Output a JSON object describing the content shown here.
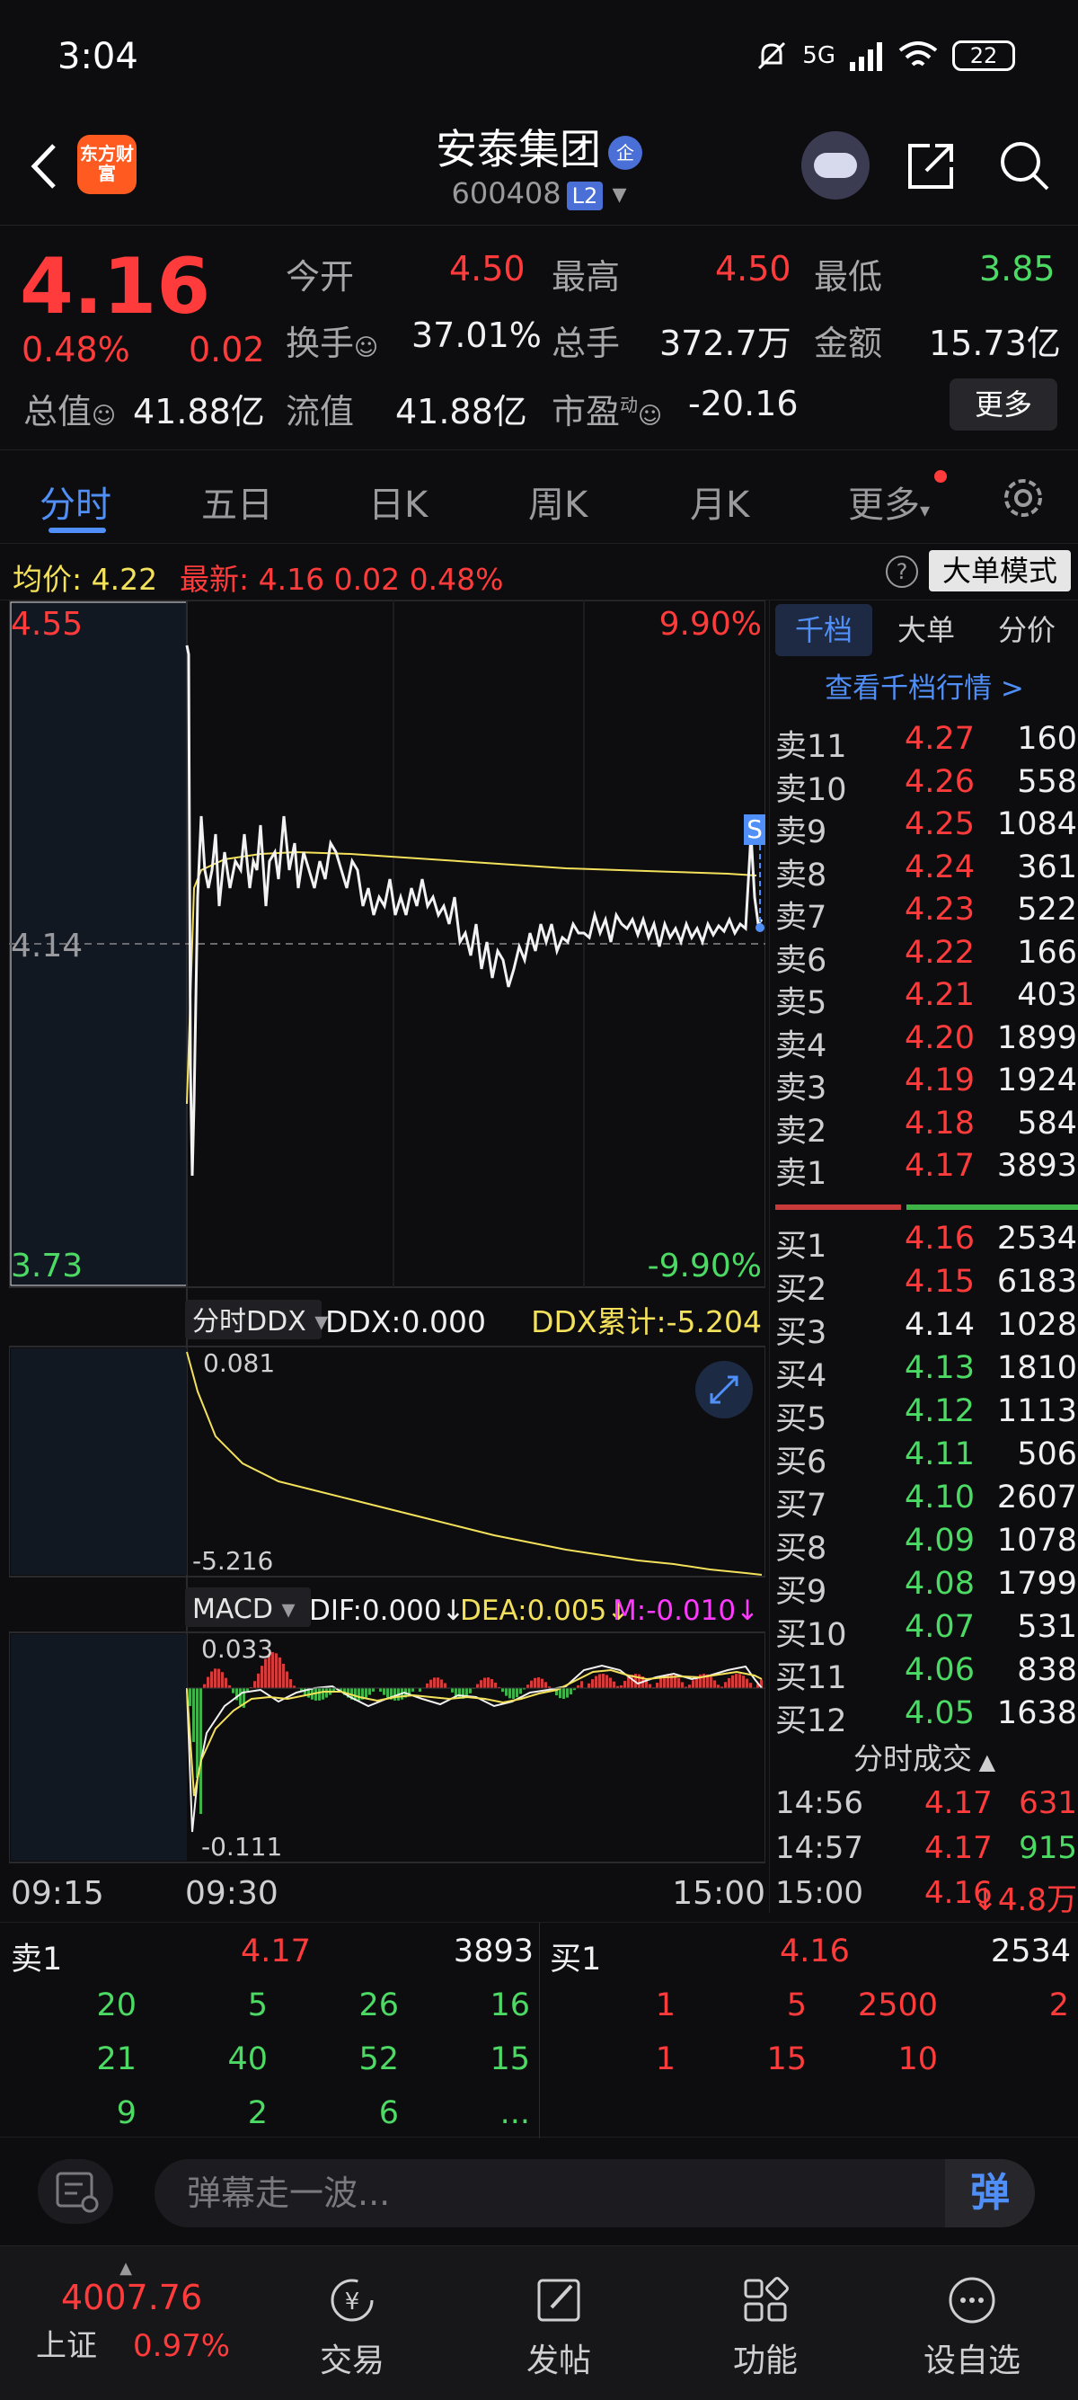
{
  "status": {
    "time": "3:04",
    "network": "5G",
    "battery": "22"
  },
  "header": {
    "logo": "东方财富",
    "name": "安泰集团",
    "ent_badge": "企",
    "code": "600408",
    "level": "L2"
  },
  "quote": {
    "price": "4.16",
    "pct": "0.48%",
    "change": "0.02",
    "fields": [
      {
        "label": "今开",
        "value": "4.50",
        "color": "red"
      },
      {
        "label": "最高",
        "value": "4.50",
        "color": "red"
      },
      {
        "label": "最低",
        "value": "3.85",
        "color": "green"
      },
      {
        "label": "换手",
        "value": "37.01%",
        "color": "white"
      },
      {
        "label": "总手",
        "value": "372.7万",
        "color": "white"
      },
      {
        "label": "金额",
        "value": "15.73亿",
        "color": "white"
      },
      {
        "label": "总值",
        "value": "41.88亿",
        "color": "white"
      },
      {
        "label": "流值",
        "value": "41.88亿",
        "color": "white"
      },
      {
        "label": "市盈",
        "value": "-20.16",
        "color": "white"
      }
    ],
    "pe_sup": "动",
    "more": "更多"
  },
  "tabs": [
    "分时",
    "五日",
    "日K",
    "周K",
    "月K",
    "更多"
  ],
  "info_line": {
    "avg_label": "均价:",
    "avg": "4.22",
    "latest_label": "最新:",
    "latest": "4.16",
    "change": "0.02",
    "pct": "0.48%",
    "mode": "大单模式"
  },
  "chart": {
    "price_high": "4.55",
    "price_mid": "4.14",
    "price_low": "3.73",
    "pct_high": "9.90%",
    "pct_low": "-9.90%",
    "ddx_selector": "分时DDX",
    "ddx": "DDX:0.000",
    "ddx_cum": "DDX累计:-5.204",
    "ddx_top": "0.081",
    "ddx_bottom": "-5.216",
    "macd_selector": "MACD",
    "dif": "DIF:0.000",
    "dea": "DEA:0.005",
    "m": "M:-0.010",
    "macd_top": "0.033",
    "macd_bottom": "-0.111",
    "time_start": "09:15",
    "time_open": "09:30",
    "time_end": "15:00",
    "s_marker": "S"
  },
  "book": {
    "tabs": [
      "千档",
      "大单",
      "分价"
    ],
    "view_link": "查看千档行情 >",
    "asks": [
      {
        "label": "卖11",
        "price": "4.27",
        "vol": "160"
      },
      {
        "label": "卖10",
        "price": "4.26",
        "vol": "558"
      },
      {
        "label": "卖9",
        "price": "4.25",
        "vol": "1084"
      },
      {
        "label": "卖8",
        "price": "4.24",
        "vol": "361"
      },
      {
        "label": "卖7",
        "price": "4.23",
        "vol": "522"
      },
      {
        "label": "卖6",
        "price": "4.22",
        "vol": "166"
      },
      {
        "label": "卖5",
        "price": "4.21",
        "vol": "403"
      },
      {
        "label": "卖4",
        "price": "4.20",
        "vol": "1899"
      },
      {
        "label": "卖3",
        "price": "4.19",
        "vol": "1924"
      },
      {
        "label": "卖2",
        "price": "4.18",
        "vol": "584"
      },
      {
        "label": "卖1",
        "price": "4.17",
        "vol": "3893"
      }
    ],
    "bids": [
      {
        "label": "买1",
        "price": "4.16",
        "vol": "2534",
        "color": "red"
      },
      {
        "label": "买2",
        "price": "4.15",
        "vol": "6183",
        "color": "red"
      },
      {
        "label": "买3",
        "price": "4.14",
        "vol": "1028",
        "color": "white"
      },
      {
        "label": "买4",
        "price": "4.13",
        "vol": "1810",
        "color": "green"
      },
      {
        "label": "买5",
        "price": "4.12",
        "vol": "1113",
        "color": "green"
      },
      {
        "label": "买6",
        "price": "4.11",
        "vol": "506",
        "color": "green"
      },
      {
        "label": "买7",
        "price": "4.10",
        "vol": "2607",
        "color": "green"
      },
      {
        "label": "买8",
        "price": "4.09",
        "vol": "1078",
        "color": "green"
      },
      {
        "label": "买9",
        "price": "4.08",
        "vol": "1799",
        "color": "green"
      },
      {
        "label": "买10",
        "price": "4.07",
        "vol": "531",
        "color": "green"
      },
      {
        "label": "买11",
        "price": "4.06",
        "vol": "838",
        "color": "green"
      },
      {
        "label": "买12",
        "price": "4.05",
        "vol": "1638",
        "color": "green"
      }
    ],
    "ticks_title": "分时成交",
    "ticks": [
      {
        "time": "14:56",
        "price": "4.17",
        "vol": "631",
        "color": "red"
      },
      {
        "time": "14:57",
        "price": "4.17",
        "vol": "915",
        "color": "green"
      },
      {
        "time": "15:00",
        "price": "4.16",
        "vol": "↓4.8万",
        "color": "red"
      }
    ]
  },
  "levels": {
    "sell_label": "卖1",
    "sell_price": "4.17",
    "sell_vol": "3893",
    "buy_label": "买1",
    "buy_price": "4.16",
    "buy_vol": "2534",
    "sell_rows": [
      [
        "20",
        "5",
        "26",
        "16"
      ],
      [
        "21",
        "40",
        "52",
        "15"
      ],
      [
        "9",
        "2",
        "6",
        "..."
      ]
    ],
    "buy_rows": [
      [
        "1",
        "5",
        "2500",
        "2"
      ],
      [
        "1",
        "15",
        "10",
        ""
      ]
    ]
  },
  "danmu": {
    "placeholder": "弹幕走一波...",
    "send": "弹"
  },
  "bottom_nav": {
    "index_value": "4007.76",
    "index_name": "上证",
    "index_pct": "0.97%",
    "items": [
      "交易",
      "发帖",
      "功能",
      "设自选"
    ]
  }
}
